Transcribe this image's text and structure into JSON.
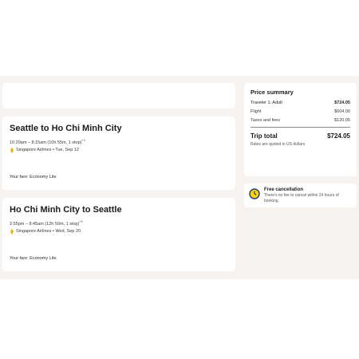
{
  "flights": {
    "outbound": {
      "route": "Seattle to Ho Chi Minh City",
      "times": "10:20am – 8:15am (10h 55m, 1 stop)",
      "day_offset": "+1",
      "airline_line": "Singapore Airlines • Tue, Sep 12",
      "fare": "Your fare: Economy Lite"
    },
    "return": {
      "route": "Ho Chi Minh City to Seattle",
      "times": "2:55pm – 8:45am (12h 50m, 1 stop)",
      "day_offset": "+1",
      "airline_line": "Singapore Airlines • Wed, Sep 20",
      "fare": "Your fare: Economy Lite"
    }
  },
  "price_summary": {
    "title": "Price summary",
    "traveler_label": "Traveler 1: Adult",
    "traveler_amount": "$724.05",
    "flight_label": "Flight",
    "flight_amount": "$604.00",
    "taxes_label": "Taxes and fees",
    "taxes_amount": "$120.05",
    "total_label": "Trip total",
    "total_amount": "$724.05",
    "note": "Rates are quoted in US dollars"
  },
  "free_cancellation": {
    "title": "Free cancellation",
    "description": "There's no fee to cancel within 24 hours of booking."
  },
  "colors": {
    "band": "#f5f2f0",
    "airline_logo": "#e6b800",
    "clock_outline": "#1a3a8f",
    "clock_fill": "#ffd400"
  },
  "icons": {
    "airline": "singapore-airlines-logo",
    "cancellation": "clock-icon"
  }
}
